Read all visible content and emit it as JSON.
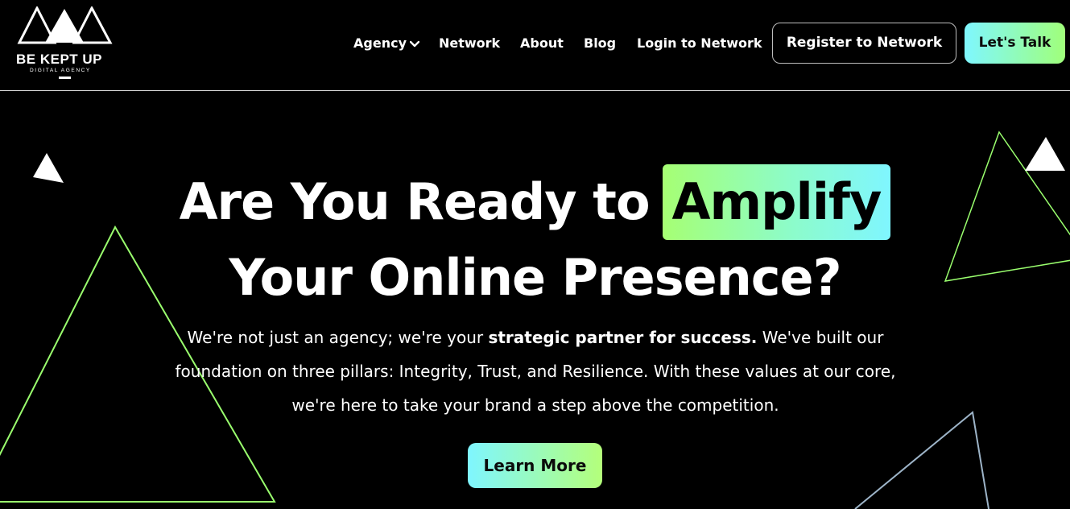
{
  "header": {
    "logo": {
      "name": "BE KEPT UP",
      "tagline": "DIGITAL AGENCY"
    },
    "nav": {
      "agency": "Agency",
      "network": "Network",
      "about": "About",
      "blog": "Blog",
      "login": "Login to Network"
    },
    "register_button": "Register to Network",
    "talk_button": "Let's Talk"
  },
  "hero": {
    "title_part1": "Are You Ready to",
    "title_highlight": "Amplify",
    "title_line2": "Your Online Presence?",
    "paragraph_before_bold": "We're not just an agency; we're your ",
    "paragraph_bold": "strategic partner for success.",
    "paragraph_after_bold": " We've built our foundation on three pillars: Integrity, Trust, and Resilience. With these values at our core, we're here to take your brand a step above the competition.",
    "cta_button": "Learn More"
  },
  "colors": {
    "background": "#000000",
    "text": "#ffffff",
    "accent_green": "#a0ff7a",
    "accent_cyan": "#7ff7ff",
    "triangle_green": "#9aff6e",
    "triangle_blue": "#9db4c8"
  },
  "icons": {
    "logo_mark": "mountains-icon",
    "agency_dropdown": "chevron-down-icon"
  }
}
